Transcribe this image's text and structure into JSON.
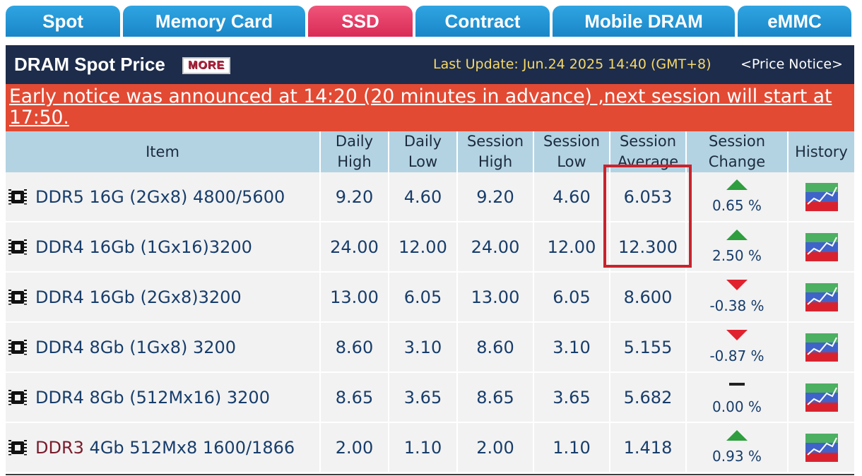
{
  "tabs": [
    {
      "label": "Spot",
      "active": false
    },
    {
      "label": "Memory Card",
      "active": false
    },
    {
      "label": "SSD",
      "active": true
    },
    {
      "label": "Contract",
      "active": false
    },
    {
      "label": "Mobile DRAM",
      "active": false
    },
    {
      "label": "eMMC",
      "active": false
    }
  ],
  "header": {
    "title": "DRAM Spot Price",
    "more_label": "MORE",
    "last_update": "Last Update: Jun.24 2025 14:40 (GMT+8)",
    "price_notice": "<Price Notice>"
  },
  "notice": "Early notice was announced at 14:20 (20 minutes in advance) ,next session will start at 17:50.",
  "table": {
    "headers": {
      "item": "Item",
      "daily_high": "Daily High",
      "daily_low": "Daily Low",
      "session_high": "Session High",
      "session_low": "Session Low",
      "session_average": "Session Average",
      "session_change": "Session Change",
      "history": "History"
    },
    "rows": [
      {
        "item": "DDR5 16G (2Gx8) 4800/5600",
        "daily_high": "9.20",
        "daily_low": "4.60",
        "session_high": "9.20",
        "session_low": "4.60",
        "session_average": "6.053",
        "change": "0.65 %",
        "direction": "up"
      },
      {
        "item": "DDR4 16Gb (1Gx16)3200",
        "daily_high": "24.00",
        "daily_low": "12.00",
        "session_high": "24.00",
        "session_low": "12.00",
        "session_average": "12.300",
        "change": "2.50 %",
        "direction": "up"
      },
      {
        "item": "DDR4 16Gb (2Gx8)3200",
        "daily_high": "13.00",
        "daily_low": "6.05",
        "session_high": "13.00",
        "session_low": "6.05",
        "session_average": "8.600",
        "change": "-0.38 %",
        "direction": "down"
      },
      {
        "item": "DDR4 8Gb (1Gx8) 3200",
        "daily_high": "8.60",
        "daily_low": "3.10",
        "session_high": "8.60",
        "session_low": "3.10",
        "session_average": "5.155",
        "change": "-0.87 %",
        "direction": "down"
      },
      {
        "item": "DDR4 8Gb (512Mx16) 3200",
        "daily_high": "8.65",
        "daily_low": "3.65",
        "session_high": "8.65",
        "session_low": "3.65",
        "session_average": "5.682",
        "change": "0.00 %",
        "direction": "flat"
      },
      {
        "item_prefix": "DDR3",
        "item": "4Gb 512Mx8 1600/1866",
        "daily_high": "2.00",
        "daily_low": "1.10",
        "session_high": "2.00",
        "session_low": "1.10",
        "session_average": "1.418",
        "change": "0.93 %",
        "direction": "up"
      }
    ]
  },
  "colors": {
    "tab": "#1a86c7",
    "tab_active": "#d82b56",
    "header_bg": "#1d2c4a",
    "notice_bg": "#e24a33",
    "highlight": "#c9232c",
    "up": "#2e9e3e",
    "down": "#e0222f"
  }
}
